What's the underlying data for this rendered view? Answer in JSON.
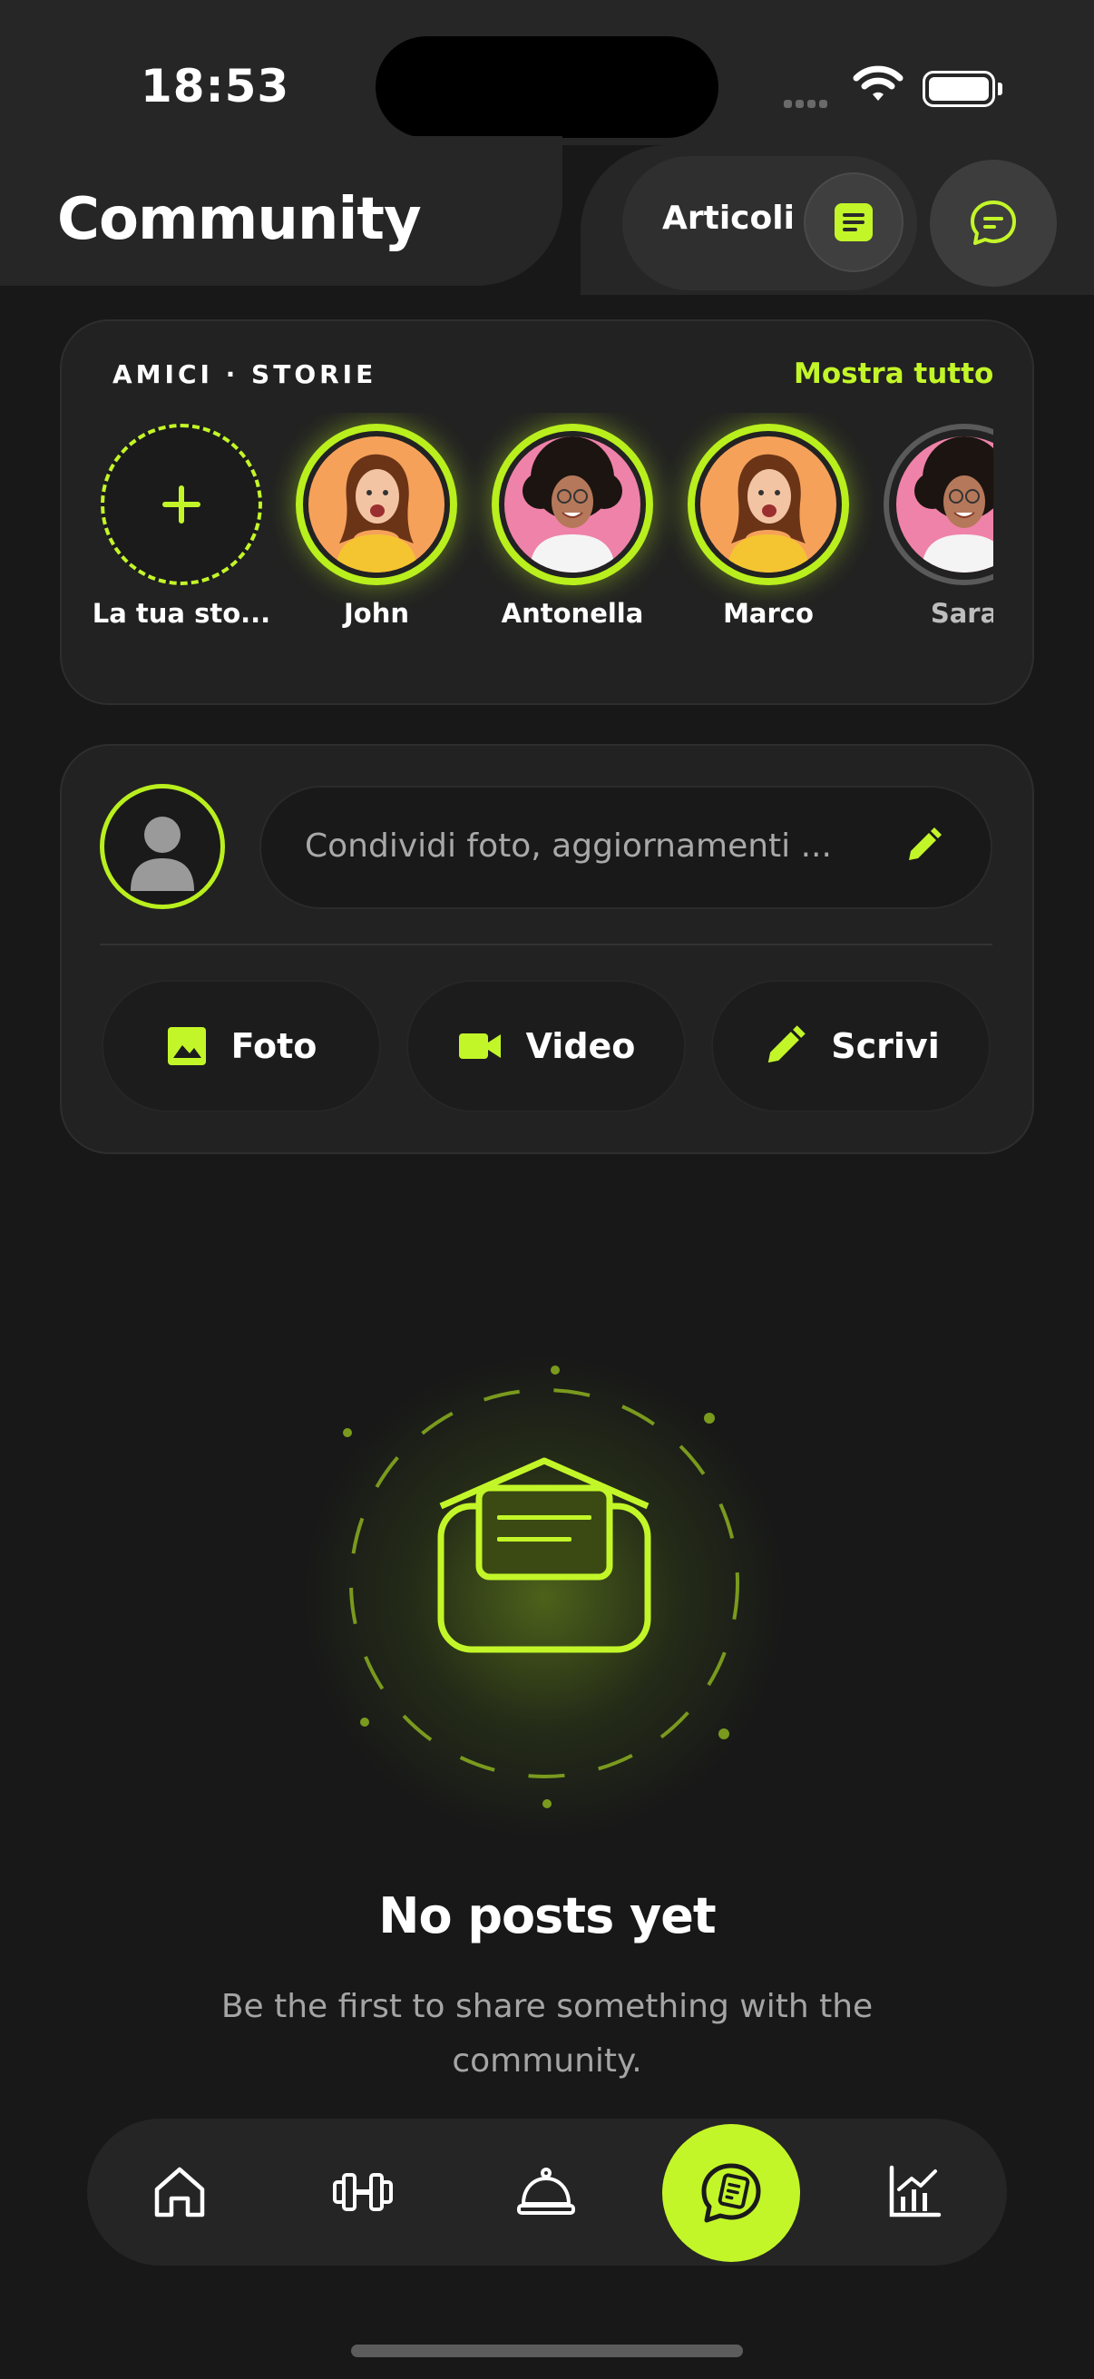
{
  "status_bar": {
    "time": "18:53"
  },
  "header": {
    "title": "Community",
    "articles_label": "Articoli"
  },
  "stories": {
    "section_title": "AMICI · STORIE",
    "show_all": "Mostra tutto",
    "items": [
      {
        "name": "La tua sto...",
        "type": "add"
      },
      {
        "name": "John",
        "type": "active",
        "avatar": "orange"
      },
      {
        "name": "Antonella",
        "type": "active",
        "avatar": "pink"
      },
      {
        "name": "Marco",
        "type": "active",
        "avatar": "orange"
      },
      {
        "name": "Sara",
        "type": "seen",
        "avatar": "pink"
      }
    ]
  },
  "composer": {
    "placeholder": "Condividi foto, aggiornamenti ...",
    "actions": [
      {
        "label": "Foto",
        "icon": "image-icon"
      },
      {
        "label": "Video",
        "icon": "video-camera-icon"
      },
      {
        "label": "Scrivi",
        "icon": "pencil-icon"
      }
    ]
  },
  "empty_state": {
    "title": "No posts yet",
    "subtitle": "Be the first to share something with the community."
  },
  "bottom_nav": {
    "items": [
      "home-icon",
      "dumbbell-icon",
      "cloche-icon",
      "community-chat-icon",
      "chart-icon"
    ],
    "active_index": 3
  },
  "colors": {
    "accent": "#c3f628",
    "background": "#181818",
    "card": "#222222"
  }
}
